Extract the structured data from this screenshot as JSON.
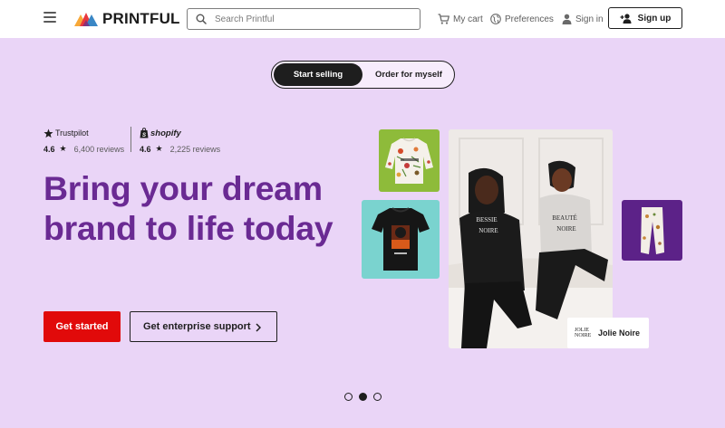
{
  "header": {
    "logo_text": "PRINTFUL",
    "search": {
      "placeholder": "Search Printful",
      "value": ""
    },
    "cart_label": "My cart",
    "preferences_label": "Preferences",
    "signin_label": "Sign in",
    "signup_label": "Sign up"
  },
  "mode_toggle": {
    "options": [
      "Start selling",
      "Order for myself"
    ],
    "selected": "Start selling"
  },
  "ratings": {
    "trustpilot": {
      "brand": "Trustpilot",
      "score": "4.6",
      "star": "★",
      "reviews": "6,400 reviews"
    },
    "shopify": {
      "brand": "shopify",
      "score": "4.6",
      "star": "★",
      "reviews": "2,225 reviews"
    }
  },
  "hero": {
    "headline": "Bring your dream brand to life today",
    "primary_cta": "Get started",
    "secondary_cta": "Get enterprise support"
  },
  "collage": {
    "brand_card_logo": "JOLIE NOIRE",
    "brand_card_name": "Jolie Noire",
    "shirt_texts": [
      "BESSIE NOIRE",
      "BEAUTÉ NOIRE"
    ]
  },
  "carousel": {
    "total": 3,
    "active_index": 1
  },
  "colors": {
    "page_bg": "#ead5f7",
    "headline": "#6a2a93",
    "primary_cta": "#e10a0a",
    "dark": "#1e1e1e"
  }
}
